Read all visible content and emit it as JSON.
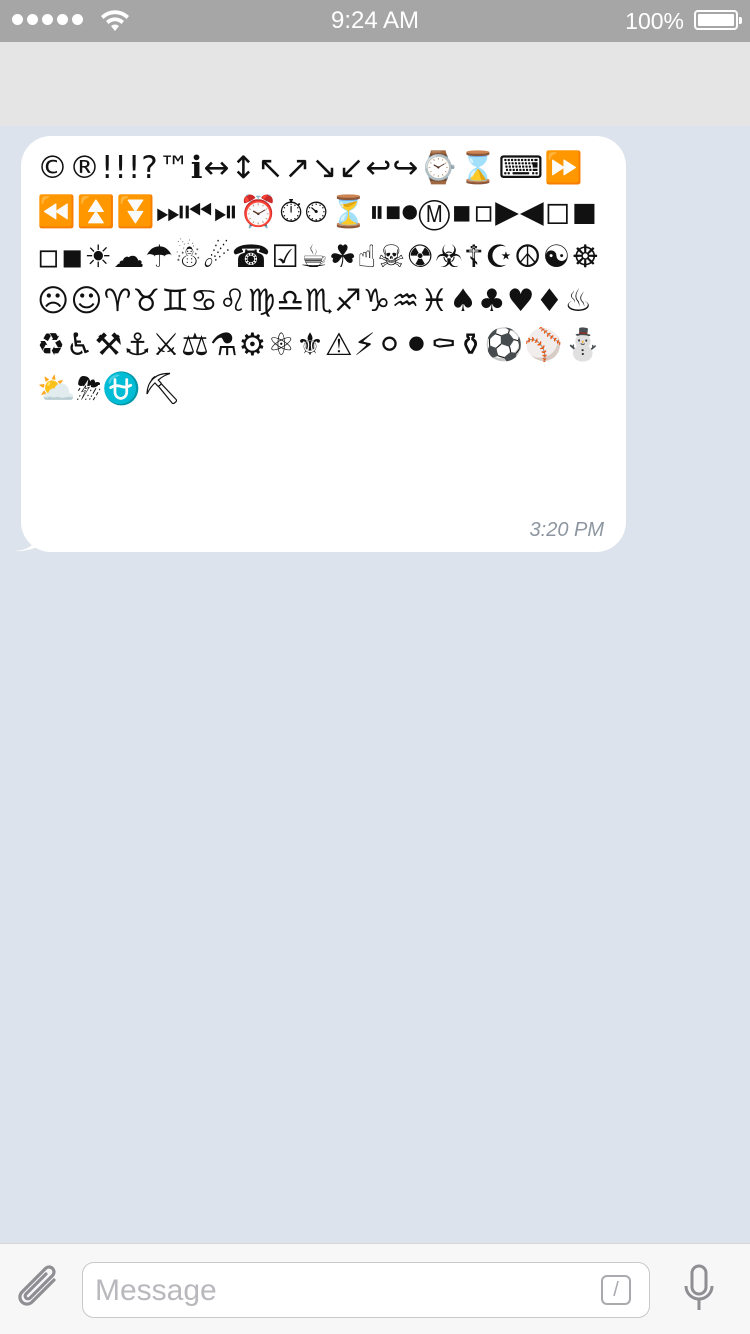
{
  "status_bar": {
    "time": "9:24 AM",
    "battery_percent": "100%",
    "signal_bars": 5,
    "icons": [
      "signal-dots-icon",
      "wifi-icon",
      "battery-icon"
    ]
  },
  "message": {
    "content": "©®!!!?™ℹ↔↕↖↗↘↙↩↪⌚⌛⌨⏩⏪⏫⏬⏭⏮⏯⏰⏱⏲⏳⏸⏹⏺Ⓜ▪▫▶◀◻◼◽◾☀☁☂☃☄☎☑☕☘☝☠☢☣☦☪☮☯☸☹☺♈♉♊♋♌♍♎♏♐♑♒♓♠♣♥♦♨♻♿⚒⚓⚔⚖⚗⚙⚛⚜⚠⚡⚪⚫⚰⚱⚽⚾⛄⛅⛈⛎⛏",
    "time": "3:20 PM"
  },
  "input_bar": {
    "placeholder": "Message",
    "slash_label": "/",
    "icons": [
      "paperclip-icon",
      "slash-command-icon",
      "microphone-icon"
    ]
  },
  "colors": {
    "chat_background": "#dde3ec",
    "status_bar": "#a6a6a6",
    "bubble": "#ffffff",
    "timestamp": "#8d96a0"
  }
}
